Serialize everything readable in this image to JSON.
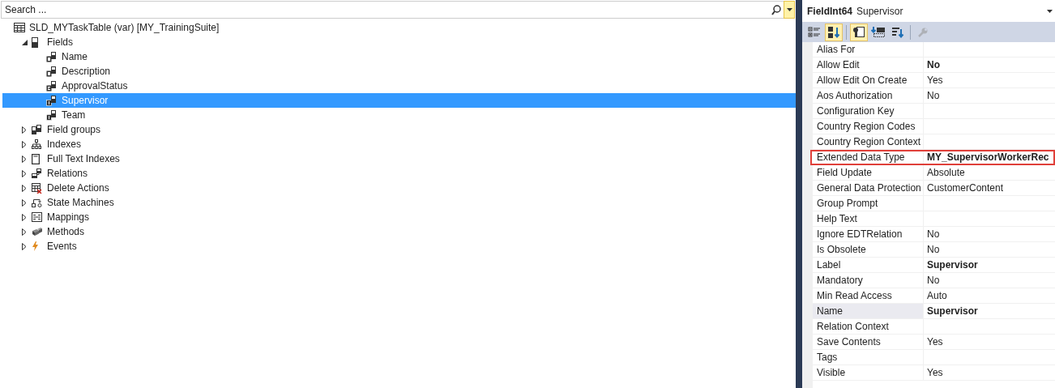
{
  "search": {
    "placeholder": "Search ..."
  },
  "tree": [
    {
      "label": "SLD_MYTaskTable (var) [MY_TrainingSuite]",
      "kind": "table",
      "selected": false,
      "children": [
        {
          "label": "Fields",
          "kind": "fields",
          "expanded": true,
          "selected": false,
          "children": [
            {
              "label": "Name",
              "kind": "string-field",
              "selected": false
            },
            {
              "label": "Description",
              "kind": "string-field",
              "selected": false
            },
            {
              "label": "ApprovalStatus",
              "kind": "enum-field",
              "selected": false
            },
            {
              "label": "Supervisor",
              "kind": "int-field",
              "selected": true
            },
            {
              "label": "Team",
              "kind": "int-field",
              "selected": false
            }
          ]
        },
        {
          "label": "Field groups",
          "kind": "field-groups",
          "expanded": false,
          "selected": false
        },
        {
          "label": "Indexes",
          "kind": "indexes",
          "expanded": false,
          "selected": false
        },
        {
          "label": "Full Text Indexes",
          "kind": "fulltext",
          "expanded": false,
          "selected": false
        },
        {
          "label": "Relations",
          "kind": "relations",
          "expanded": false,
          "selected": false
        },
        {
          "label": "Delete Actions",
          "kind": "delete-actions",
          "expanded": false,
          "selected": false
        },
        {
          "label": "State Machines",
          "kind": "state-machines",
          "expanded": false,
          "selected": false
        },
        {
          "label": "Mappings",
          "kind": "mappings",
          "expanded": false,
          "selected": false
        },
        {
          "label": "Methods",
          "kind": "methods",
          "expanded": false,
          "selected": false
        },
        {
          "label": "Events",
          "kind": "events",
          "expanded": false,
          "selected": false
        }
      ]
    }
  ],
  "properties": {
    "object_type": "FieldInt64",
    "object_name": "Supervisor",
    "toolbar": [
      {
        "kind": "categorized",
        "selected": false
      },
      {
        "kind": "alphabetical",
        "selected": true
      },
      {
        "kind": "separator"
      },
      {
        "kind": "properties",
        "selected": true
      },
      {
        "kind": "events",
        "selected": false
      },
      {
        "kind": "sort",
        "selected": false
      },
      {
        "kind": "separator"
      },
      {
        "kind": "wrench",
        "selected": false,
        "disabled": true
      }
    ],
    "rows": [
      {
        "name": "Alias For",
        "selected": false
      },
      {
        "name": "Allow Edit",
        "value": "No",
        "bold": true,
        "selected": false
      },
      {
        "name": "Allow Edit On Create",
        "value": "Yes",
        "bold": false,
        "selected": false
      },
      {
        "name": "Aos Authorization",
        "value": "No",
        "bold": false,
        "selected": false
      },
      {
        "name": "Configuration Key",
        "selected": false
      },
      {
        "name": "Country Region Codes",
        "selected": false
      },
      {
        "name": "Country Region Context",
        "selected": false
      },
      {
        "name": "Extended Data Type",
        "value": "MY_SupervisorWorkerRec",
        "bold": true,
        "selected": false,
        "highlighted": true
      },
      {
        "name": "Field Update",
        "value": "Absolute",
        "bold": false,
        "selected": false
      },
      {
        "name": "General Data Protection",
        "value": "CustomerContent",
        "bold": false,
        "selected": false
      },
      {
        "name": "Group Prompt",
        "selected": false
      },
      {
        "name": "Help Text",
        "selected": false
      },
      {
        "name": "Ignore EDTRelation",
        "value": "No",
        "bold": false,
        "selected": false
      },
      {
        "name": "Is Obsolete",
        "value": "No",
        "bold": false,
        "selected": false
      },
      {
        "name": "Label",
        "value": "Supervisor",
        "bold": true,
        "selected": false
      },
      {
        "name": "Mandatory",
        "value": "No",
        "bold": false,
        "selected": false
      },
      {
        "name": "Min Read Access",
        "value": "Auto",
        "bold": false,
        "selected": false
      },
      {
        "name": "Name",
        "value": "Supervisor",
        "bold": true,
        "selected": true
      },
      {
        "name": "Relation Context",
        "selected": false
      },
      {
        "name": "Save Contents",
        "value": "Yes",
        "bold": false,
        "selected": false
      },
      {
        "name": "Tags",
        "selected": false
      },
      {
        "name": "Visible",
        "value": "Yes",
        "bold": false,
        "selected": false
      }
    ]
  }
}
